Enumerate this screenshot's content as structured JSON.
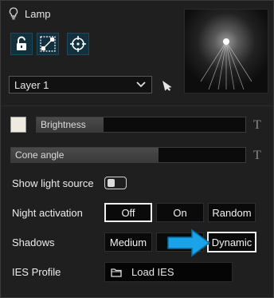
{
  "header": {
    "title": "Lamp",
    "icon": "lightbulb-icon"
  },
  "toolbar": {
    "icons": [
      "unlock-icon",
      "scale-handle-icon",
      "crosshair-target-icon"
    ]
  },
  "layer": {
    "selected": "Layer 1",
    "icon": "chevron-down-icon"
  },
  "brightness": {
    "label": "Brightness",
    "value": 0.32
  },
  "cone": {
    "label": "Cone angle",
    "value": 0.63
  },
  "show_light_source": {
    "label": "Show light source",
    "enabled": false
  },
  "night_activation": {
    "label": "Night activation",
    "options": [
      "Off",
      "On",
      "Random"
    ],
    "selected": "Off"
  },
  "shadows": {
    "label": "Shadows",
    "options": [
      "Medium",
      "",
      "Dynamic"
    ],
    "selected": "Dynamic"
  },
  "ies": {
    "label": "IES Profile",
    "button": "Load IES",
    "icon": "folder-icon"
  },
  "text_glyph": "T",
  "colors": {
    "light_color": "#eeeadf",
    "accent_arrow": "#1aa3e8",
    "toolbar_bg": "#12303d"
  }
}
